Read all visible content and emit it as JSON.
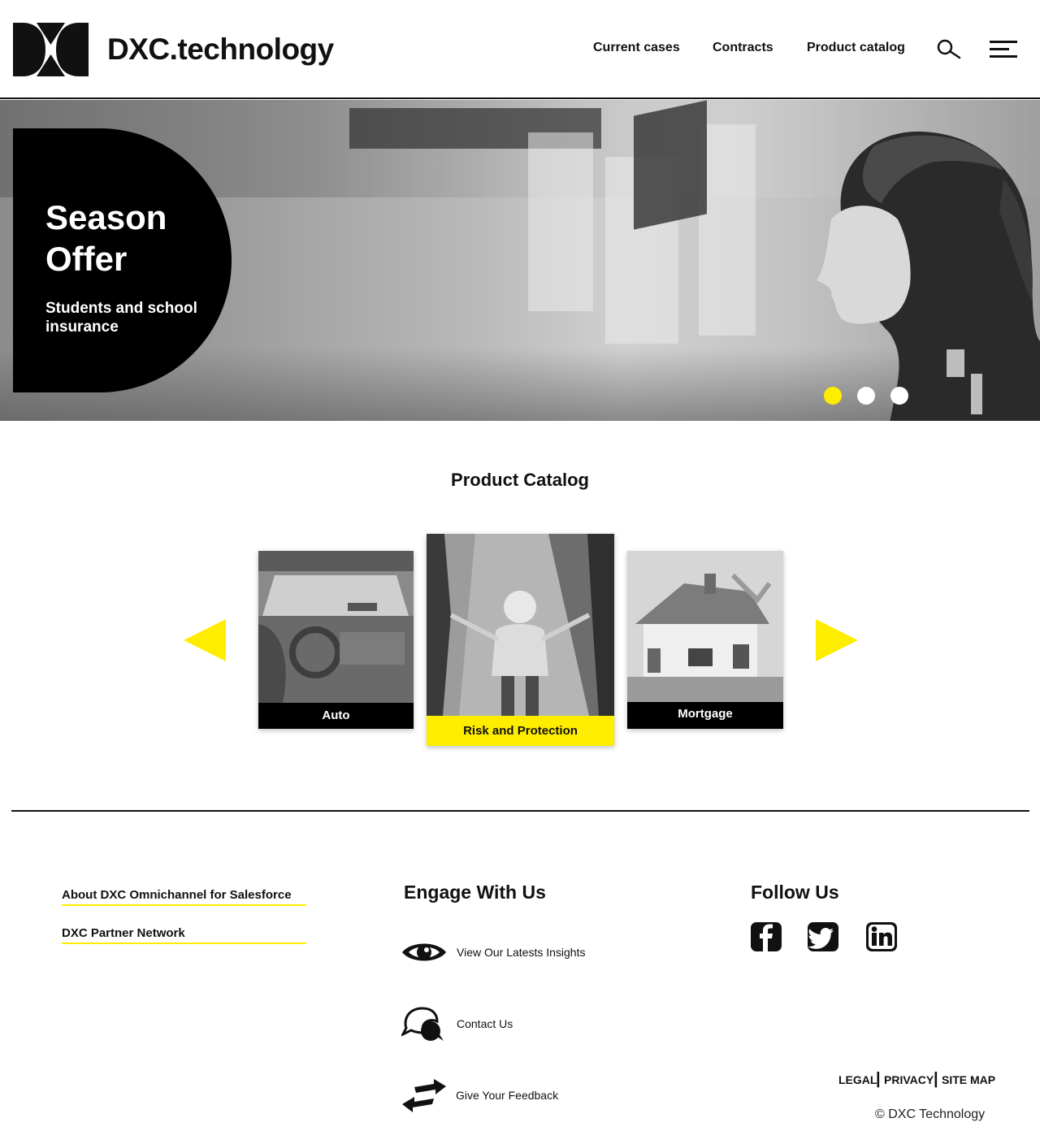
{
  "brand": {
    "name": "DXC.technology"
  },
  "nav": {
    "items": [
      {
        "label": "Current cases"
      },
      {
        "label": "Contracts"
      },
      {
        "label": "Product catalog"
      }
    ],
    "search_icon": "search-icon",
    "menu_icon": "hamburger-menu-icon"
  },
  "hero": {
    "title": "Season Offer",
    "subtitle": "Students and school insurance",
    "slides": 3,
    "active_slide": 1
  },
  "catalog": {
    "title": "Product Catalog",
    "cards": [
      {
        "label": "Auto"
      },
      {
        "label": "Risk and Protection"
      },
      {
        "label": "Mortgage"
      }
    ],
    "selected": "Risk and Protection"
  },
  "footer": {
    "links": [
      {
        "label": "About DXC Omnichannel for Salesforce"
      },
      {
        "label": "DXC Partner Network"
      }
    ],
    "engage": {
      "heading": "Engage With Us",
      "items": [
        {
          "label": "View Our Latests Insights",
          "icon": "eye-icon"
        },
        {
          "label": "Contact Us",
          "icon": "chat-icon"
        },
        {
          "label": "Give Your Feedback",
          "icon": "exchange-arrows-icon"
        }
      ]
    },
    "follow": {
      "heading": "Follow Us",
      "networks": [
        "facebook-icon",
        "twitter-icon",
        "linkedin-icon"
      ]
    },
    "legal": [
      "LEGAL",
      "PRIVACY",
      "SITE MAP"
    ],
    "copyright": "© DXC Technology"
  },
  "colors": {
    "accent": "#ffed00",
    "text": "#111111",
    "background": "#ffffff"
  }
}
